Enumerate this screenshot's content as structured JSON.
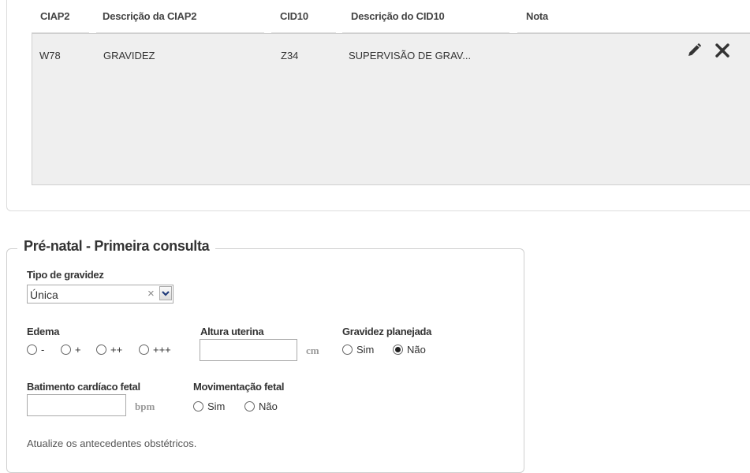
{
  "grid": {
    "columns": [
      "CIAP2",
      "Descrição da CIAP2",
      "CID10",
      "Descrição do CID10",
      "Nota"
    ],
    "rows": [
      {
        "ciap2": "W78",
        "desc_ciap2": "GRAVIDEZ",
        "cid10": "Z34",
        "desc_cid10": "SUPERVISÃO DE GRAV...",
        "nota": ""
      }
    ],
    "actions": {
      "edit_icon": "pencil-icon",
      "delete_icon": "close-icon"
    }
  },
  "prenatal": {
    "title": "Pré-natal - Primeira consulta",
    "tipo_gravidez": {
      "label": "Tipo de gravidez",
      "value": "Única",
      "clear": "×"
    },
    "edema": {
      "label": "Edema",
      "options": [
        "-",
        "+",
        "++",
        "+++"
      ]
    },
    "altura_uterina": {
      "label": "Altura uterina",
      "unit": "cm",
      "value": ""
    },
    "gravidez_planejada": {
      "label": "Gravidez planejada",
      "options": [
        "Sim",
        "Não"
      ],
      "selected": "Não"
    },
    "batimento": {
      "label": "Batimento cardíaco fetal",
      "unit": "bpm",
      "value": ""
    },
    "movimentacao": {
      "label": "Movimentação fetal",
      "options": [
        "Sim",
        "Não"
      ]
    },
    "hint": "Atualize os antecedentes obstétricos."
  }
}
